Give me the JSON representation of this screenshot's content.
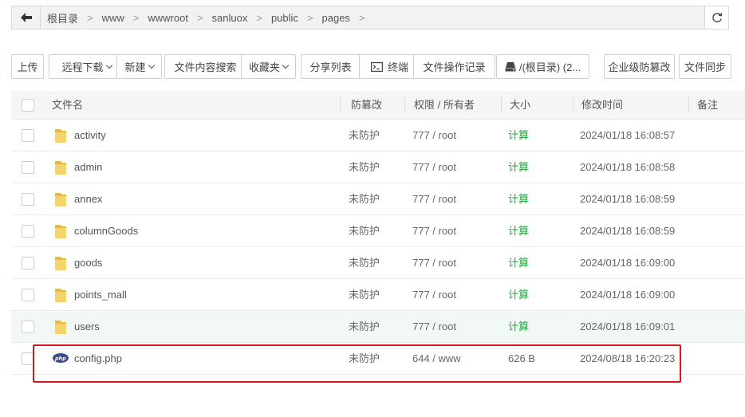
{
  "path": {
    "crumbs": [
      "根目录",
      "www",
      "wwwroot",
      "sanluox",
      "public",
      "pages"
    ],
    "separator": ">"
  },
  "toolbar": {
    "upload": "上传",
    "remote_download": "远程下载",
    "new": "新建",
    "content_search": "文件内容搜索",
    "favorites": "收藏夹",
    "share_list": "分享列表",
    "terminal": "终端",
    "op_log": "文件操作记录",
    "disk": "/(根目录) (2...",
    "tamper_proof": "企业级防篡改",
    "file_sync": "文件同步"
  },
  "table": {
    "headers": {
      "name": "文件名",
      "protect": "防篡改",
      "perm_owner": "权限 / 所有者",
      "size": "大小",
      "mtime": "修改时间",
      "note": "备注"
    },
    "rows": [
      {
        "name": "activity",
        "type": "folder",
        "protect": "未防护",
        "perm": "777 / root",
        "size": "计算",
        "mtime": "2024/01/18 16:08:57"
      },
      {
        "name": "admin",
        "type": "folder",
        "protect": "未防护",
        "perm": "777 / root",
        "size": "计算",
        "mtime": "2024/01/18 16:08:58"
      },
      {
        "name": "annex",
        "type": "folder",
        "protect": "未防护",
        "perm": "777 / root",
        "size": "计算",
        "mtime": "2024/01/18 16:08:59"
      },
      {
        "name": "columnGoods",
        "type": "folder",
        "protect": "未防护",
        "perm": "777 / root",
        "size": "计算",
        "mtime": "2024/01/18 16:08:59"
      },
      {
        "name": "goods",
        "type": "folder",
        "protect": "未防护",
        "perm": "777 / root",
        "size": "计算",
        "mtime": "2024/01/18 16:09:00"
      },
      {
        "name": "points_mall",
        "type": "folder",
        "protect": "未防护",
        "perm": "777 / root",
        "size": "计算",
        "mtime": "2024/01/18 16:09:00"
      },
      {
        "name": "users",
        "type": "folder",
        "protect": "未防护",
        "perm": "777 / root",
        "size": "计算",
        "mtime": "2024/01/18 16:09:01"
      },
      {
        "name": "config.php",
        "type": "php",
        "protect": "未防护",
        "perm": "644 / www",
        "size": "626 B",
        "mtime": "2024/08/18 16:20:23"
      }
    ]
  },
  "colors": {
    "calc_link": "#20a53a",
    "highlight_row": "#f2f8f6",
    "selection_box": "#d7191f",
    "folder": "#f5c85a",
    "php_badge": "#3b4b8a"
  },
  "icons": {
    "back": "arrow-left-icon",
    "refresh": "refresh-icon",
    "terminal": "terminal-icon",
    "disk": "disk-icon",
    "folder": "folder-icon",
    "php": "php-file-icon"
  }
}
